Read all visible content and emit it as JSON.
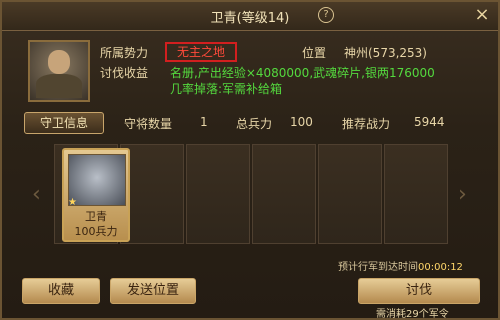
{
  "window": {
    "title": "卫青(等级14)",
    "help": "?",
    "close": "×"
  },
  "info": {
    "faction_label": "所属势力",
    "faction_value": "无主之地",
    "position_label": "位置",
    "position_value": "神州(573,253)",
    "reward_label": "讨伐收益",
    "reward_text": "名册,产出经验×4080000,武魂碎片,银两176000",
    "drop_text": "几率掉落:军需补给箱"
  },
  "tabs": {
    "guard": "守卫信息",
    "guard_count_label": "守将数量",
    "guard_count": "1",
    "troops_label": "总兵力",
    "troops": "100",
    "power_label": "推荐战力",
    "power": "5944"
  },
  "card": {
    "name": "卫青",
    "troops": "100兵力"
  },
  "eta": {
    "label": "预计行军到达时间",
    "time": "00:00:12"
  },
  "buttons": {
    "favorite": "收藏",
    "send": "发送位置",
    "attack": "讨伐"
  },
  "cost_text": "需消耗29个军令",
  "colors": {
    "faction": "#ff4a3a",
    "reward": "#54d93e"
  }
}
